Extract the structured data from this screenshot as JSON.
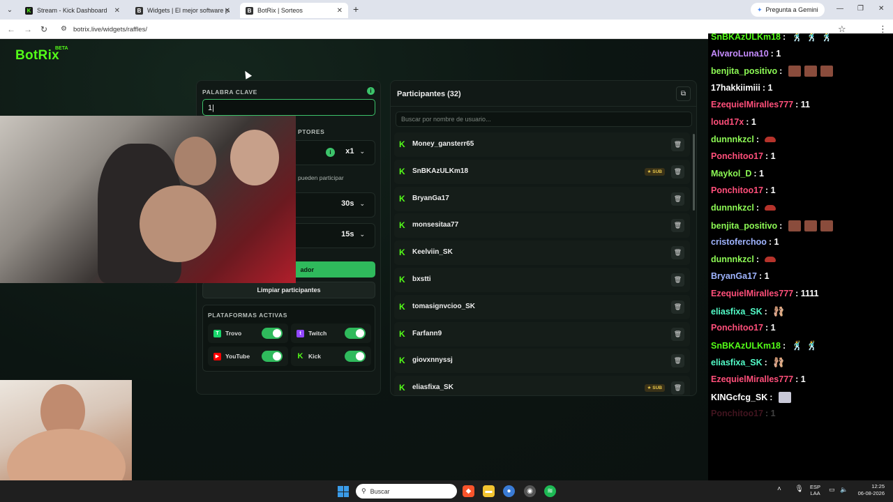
{
  "browser": {
    "tabs": [
      {
        "title": "Stream - Kick Dashboard",
        "icon": "kick-icon"
      },
      {
        "title": "Widgets | El mejor software pa",
        "icon": "botrix-icon"
      },
      {
        "title": "BotRix | Sorteos",
        "icon": "botrix-icon"
      }
    ],
    "gemini_label": "Pregunta a Gemini",
    "url": "botrix.live/widgets/raffles/"
  },
  "app": {
    "logo": "BotRix",
    "logo_badge": "BETA",
    "brand_color": "#53fc18"
  },
  "settings": {
    "keyword_label": "PALABRA CLAVE",
    "keyword_value": "1|",
    "gating_label_fragment": "PTORES",
    "multiplier_value": "x1",
    "subs_note_fragment": "pueden participar",
    "timer_value": "30s",
    "duration_value": "15s",
    "start_button_fragment": "ador",
    "clear_button": "Limpiar participantes",
    "platforms_label": "PLATAFORMAS ACTIVAS",
    "platforms": [
      {
        "name": "Trovo",
        "enabled": true,
        "color": "#19d66b"
      },
      {
        "name": "Twitch",
        "enabled": true,
        "color": "#9146ff"
      },
      {
        "name": "YouTube",
        "enabled": true,
        "color": "#ff0000"
      },
      {
        "name": "Kick",
        "enabled": true,
        "color": "#53fc18"
      }
    ]
  },
  "participants": {
    "title": "Participantes (32)",
    "search_placeholder": "Buscar por nombre de usuario...",
    "list": [
      {
        "name": "Money_gansterr65",
        "sub": false
      },
      {
        "name": "SnBKAzULKm18",
        "sub": true
      },
      {
        "name": "BryanGa17",
        "sub": false
      },
      {
        "name": "monsesitaa77",
        "sub": false
      },
      {
        "name": "Keelviin_SK",
        "sub": false
      },
      {
        "name": "bxstti",
        "sub": false
      },
      {
        "name": "tomasignvcioo_SK",
        "sub": false
      },
      {
        "name": "Farfann9",
        "sub": false
      },
      {
        "name": "giovxnnyssj",
        "sub": false
      },
      {
        "name": "eliasfixa_SK",
        "sub": true
      }
    ],
    "sub_label": "SUB"
  },
  "chat": [
    {
      "user": "SnBKAzULKm18",
      "color": "#53fc18",
      "text": "",
      "emotes": [
        "fig",
        "fig",
        "fig"
      ]
    },
    {
      "user": "AlvaroLuna10",
      "color": "#c68cff",
      "text": "1",
      "emotes": []
    },
    {
      "user": "benjita_positivo",
      "color": "#8dfa55",
      "text": "",
      "emotes": [
        "img-brown",
        "img-brown",
        "img-brown"
      ]
    },
    {
      "user": "17hakkiimiii",
      "color": "#ffffff",
      "text": "1",
      "emotes": []
    },
    {
      "user": "EzequielMiralles777",
      "color": "#ff4f7a",
      "text": "11",
      "emotes": []
    },
    {
      "user": "loud17x",
      "color": "#ff4f7a",
      "text": "1",
      "emotes": []
    },
    {
      "user": "dunnnkzcl",
      "color": "#8dfa55",
      "text": "",
      "emotes": [
        "red"
      ]
    },
    {
      "user": "Ponchitoo17",
      "color": "#ff4f7a",
      "text": "1",
      "emotes": []
    },
    {
      "user": "Maykol_D",
      "color": "#8dfa55",
      "text": "1",
      "emotes": []
    },
    {
      "user": "Ponchitoo17",
      "color": "#ff4f7a",
      "text": "1",
      "emotes": []
    },
    {
      "user": "dunnnkzcl",
      "color": "#8dfa55",
      "text": "",
      "emotes": [
        "red"
      ]
    },
    {
      "user": "benjita_positivo",
      "color": "#8dfa55",
      "text": "",
      "emotes": [
        "img-brown",
        "img-brown",
        "img-brown"
      ]
    },
    {
      "user": "cristoferchoo",
      "color": "#9fb4ff",
      "text": "1",
      "emotes": []
    },
    {
      "user": "dunnnkzcl",
      "color": "#8dfa55",
      "text": "",
      "emotes": [
        "red"
      ]
    },
    {
      "user": "BryanGa17",
      "color": "#9fb4ff",
      "text": "1",
      "emotes": []
    },
    {
      "user": "EzequielMiralles777",
      "color": "#ff4f7a",
      "text": "1111",
      "emotes": []
    },
    {
      "user": "eliasfixa_SK",
      "color": "#53fcc8",
      "text": "",
      "emotes": [
        "rose"
      ]
    },
    {
      "user": "Ponchitoo17",
      "color": "#ff4f7a",
      "text": "1",
      "emotes": []
    },
    {
      "user": "SnBKAzULKm18",
      "color": "#53fc18",
      "text": "",
      "emotes": [
        "fig",
        "fig"
      ]
    },
    {
      "user": "eliasfixa_SK",
      "color": "#53fcc8",
      "text": "",
      "emotes": [
        "rose"
      ]
    },
    {
      "user": "EzequielMiralles777",
      "color": "#ff4f7a",
      "text": "1",
      "emotes": []
    },
    {
      "user": "KINGcfcg_SK",
      "color": "#ffffff",
      "text": "",
      "emotes": [
        "img-light"
      ]
    },
    {
      "user": "Ponchitoo17",
      "color": "#ff4f7a",
      "text": "1",
      "emotes": []
    }
  ],
  "taskbar": {
    "search_placeholder": "Buscar",
    "lang_top": "ESP",
    "lang_bottom": "LAA",
    "time": "12:25",
    "date": "06-08-2026"
  }
}
